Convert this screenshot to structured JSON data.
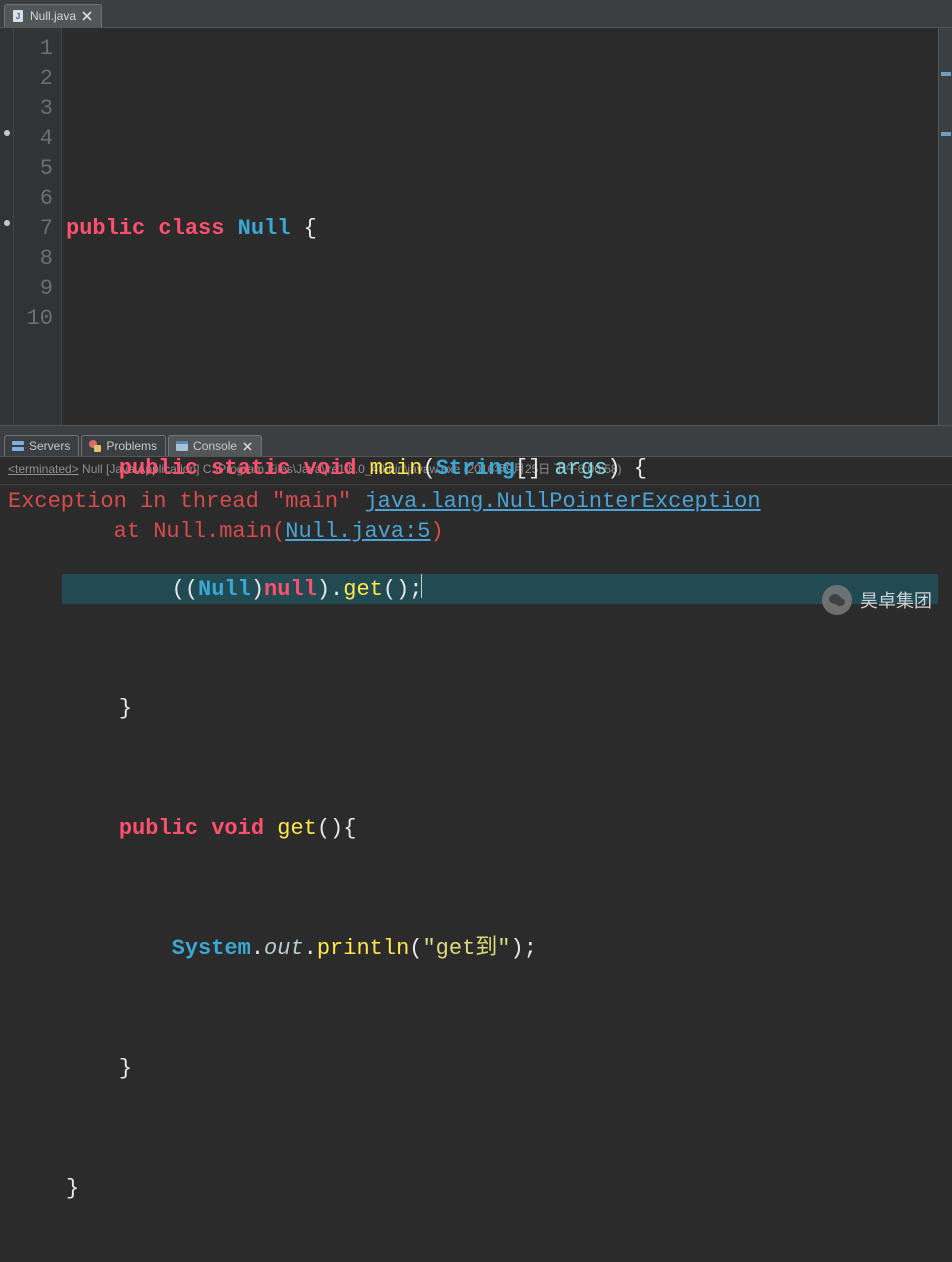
{
  "editor": {
    "tab": {
      "label": "Null.java"
    },
    "lines": {
      "l1": "",
      "l2a": "public",
      "l2b": "class",
      "l2c": "Null",
      "l2d": "{",
      "l3": "",
      "l4a": "public",
      "l4b": "static",
      "l4c": "void",
      "l4d": "main",
      "l4e": "(",
      "l4f": "String",
      "l4g": "[]",
      "l4h": "args",
      "l4i": ")",
      "l4j": "{",
      "l5a": "((",
      "l5b": "Null",
      "l5c": ")",
      "l5d": "null",
      "l5e": ").",
      "l5f": "get",
      "l5g": "();",
      "l6a": "}",
      "l7a": "public",
      "l7b": "void",
      "l7c": "get",
      "l7d": "(){",
      "l8a": "System",
      "l8b": ".",
      "l8c": "out",
      "l8d": ".",
      "l8e": "println",
      "l8f": "(",
      "l8g": "\"get到\"",
      "l8h": ");",
      "l9a": "}",
      "l10a": "}"
    },
    "gutter": [
      "1",
      "2",
      "3",
      "4",
      "5",
      "6",
      "7",
      "8",
      "9",
      "10"
    ]
  },
  "panel": {
    "tabs": {
      "servers": "Servers",
      "problems": "Problems",
      "console": "Console"
    },
    "status_prefix": "<terminated>",
    "status_rest": " Null [Java Application] C:\\Program Files\\Java\\jre1.8.0_40\\bin\\javaw.exe (2016年9月25日 下午6:06:58)"
  },
  "console": {
    "line1a": "Exception in thread \"main\" ",
    "line1b": "java.lang.NullPointerException",
    "line2a": "        at Null.main(",
    "line2b": "Null.java:5",
    "line2c": ")"
  },
  "watermark": {
    "icon": "∞",
    "text": "昊卓集团"
  }
}
